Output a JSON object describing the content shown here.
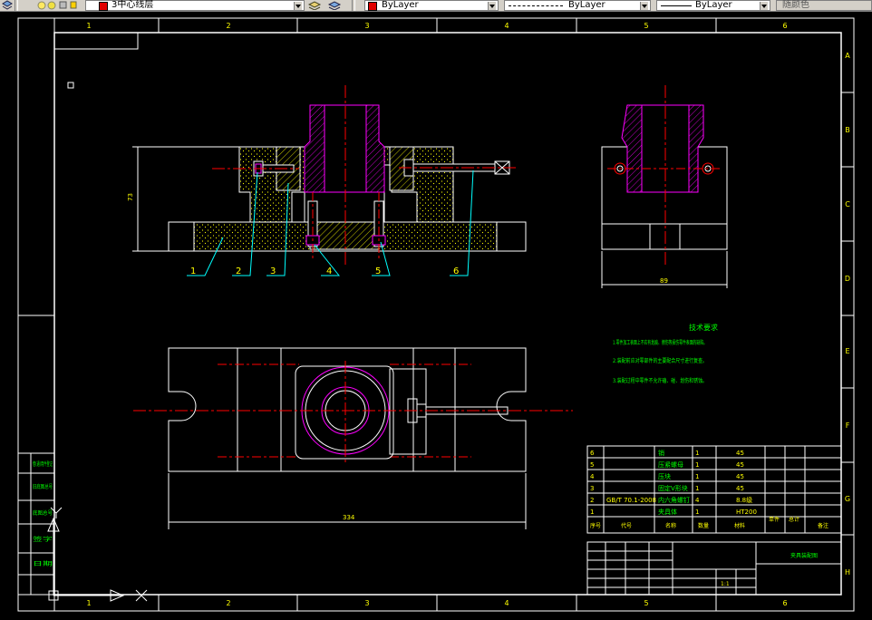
{
  "toolbar": {
    "layer_name": "3中心线层",
    "color_label": "ByLayer",
    "linetype_label": "ByLayer",
    "lineweight_label": "ByLayer",
    "plotstyle_label": "随颜色"
  },
  "drawing": {
    "border_columns": [
      "1",
      "2",
      "3",
      "4",
      "5",
      "6"
    ],
    "border_rows": [
      "A",
      "B",
      "C",
      "D",
      "E",
      "F",
      "G",
      "H"
    ],
    "balloons": [
      "1",
      "2",
      "3",
      "4",
      "5",
      "6"
    ],
    "dim_height": "73",
    "dim_side_width": "89",
    "dim_plan_length": "334",
    "tech_req_title": "技术要求",
    "tech_req_lines": [
      "1.零件加工表面上不应有划痕、擦伤等损伤零件表面的缺陷。",
      "2.装配前应对零部件的主要配合尺寸进行复查。",
      "3.装配过程中零件不允许磕、碰、划伤和锈蚀。"
    ],
    "bom_rows": [
      {
        "no": "6",
        "code": "",
        "name": "销",
        "qty": "1",
        "material": "45"
      },
      {
        "no": "5",
        "code": "",
        "name": "压紧螺母",
        "qty": "1",
        "material": "45"
      },
      {
        "no": "4",
        "code": "",
        "name": "压块",
        "qty": "1",
        "material": "45"
      },
      {
        "no": "3",
        "code": "",
        "name": "固定V形块",
        "qty": "1",
        "material": "45"
      },
      {
        "no": "2",
        "code": "GB/T 70.1-2008",
        "name": "内六角螺钉",
        "qty": "4",
        "material": "8.8级"
      },
      {
        "no": "1",
        "code": "",
        "name": "夹具体",
        "qty": "1",
        "material": "HT200"
      }
    ],
    "bom_header": [
      "序号",
      "代号",
      "名称",
      "数量",
      "材料",
      "单件",
      "总计",
      "备注"
    ],
    "title_block_name": "夹具装配图",
    "title_scale": "1:1",
    "left_strip_labels": [
      "借(通)用件登记",
      "旧底图总号",
      "底图总号",
      "签字",
      "日期"
    ]
  },
  "colors": {
    "white": "#ffffff",
    "magenta": "#ff00ff",
    "red": "#ff0000",
    "green": "#00ff00",
    "cyan": "#00ffff",
    "yellow": "#ffff00"
  }
}
